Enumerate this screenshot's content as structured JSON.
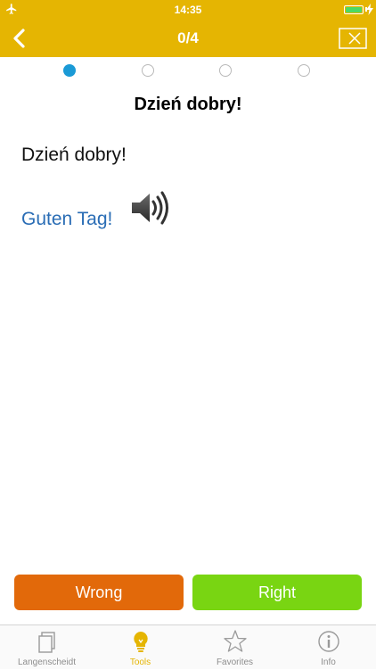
{
  "status": {
    "time": "14:35"
  },
  "nav": {
    "title": "0/4"
  },
  "progress": {
    "total": 4,
    "current_index": 0
  },
  "card": {
    "title": "Dzień dobry!",
    "source": "Dzień dobry!",
    "answer": "Guten Tag!"
  },
  "buttons": {
    "wrong": "Wrong",
    "right": "Right"
  },
  "colors": {
    "accent": "#e5b502",
    "wrong": "#e2690a",
    "right": "#79d512",
    "answer_text": "#2a6db5",
    "active_dot": "#1a9ad6"
  },
  "tabs": [
    {
      "label": "Langenscheidt",
      "icon": "book-icon",
      "active": false
    },
    {
      "label": "Tools",
      "icon": "lightbulb-icon",
      "active": true
    },
    {
      "label": "Favorites",
      "icon": "star-icon",
      "active": false
    },
    {
      "label": "Info",
      "icon": "info-icon",
      "active": false
    }
  ]
}
